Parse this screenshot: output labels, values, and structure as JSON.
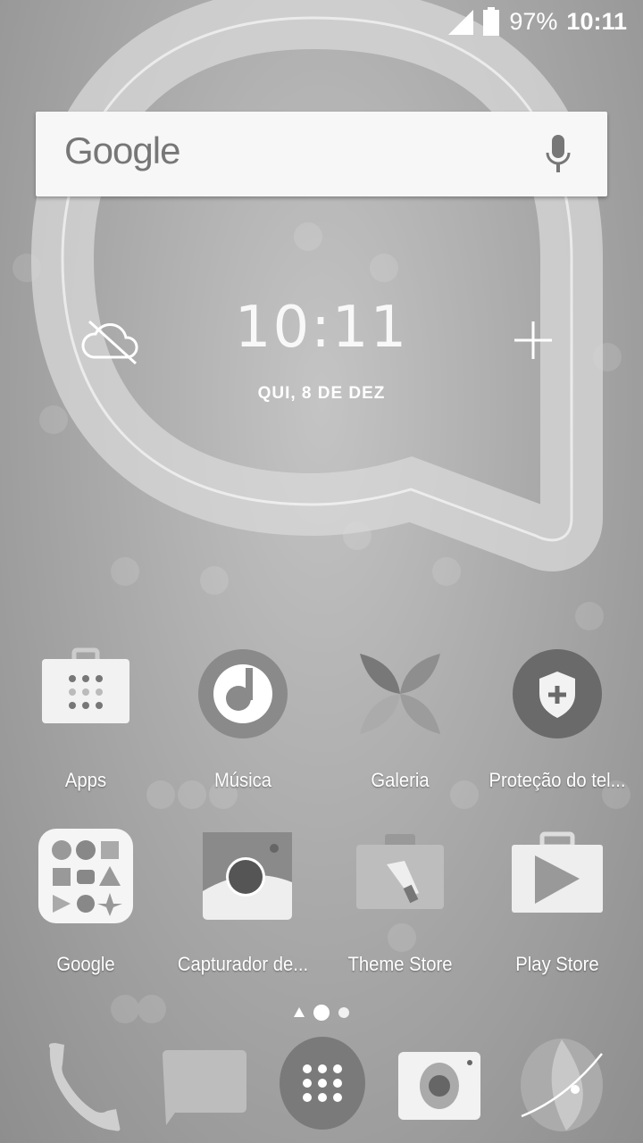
{
  "status_bar": {
    "battery": "97%",
    "time": "10:11",
    "icons": [
      "signal-icon",
      "battery-icon"
    ]
  },
  "search": {
    "logo": "Google",
    "icon": "mic-icon"
  },
  "clock_widget": {
    "time": "10:11",
    "date": "QUI, 8 DE DEZ",
    "weather_icon": "cloud-off-icon",
    "add_icon": "plus-icon"
  },
  "apps": [
    {
      "label": "Apps",
      "icon": "bag-grid-icon"
    },
    {
      "label": "Música",
      "icon": "music-icon"
    },
    {
      "label": "Galeria",
      "icon": "butterfly-icon"
    },
    {
      "label": "Proteção do tel...",
      "icon": "shield-icon"
    },
    {
      "label": "Google",
      "icon": "folder-icon"
    },
    {
      "label": "Capturador de...",
      "icon": "camera-icon"
    },
    {
      "label": "Theme Store",
      "icon": "brush-bag-icon"
    },
    {
      "label": "Play Store",
      "icon": "play-store-icon"
    }
  ],
  "page_indicator": {
    "pages": 3,
    "current": 2
  },
  "dock": [
    "phone-icon",
    "messages-icon",
    "app-drawer-icon",
    "camera-icon",
    "browser-icon"
  ]
}
